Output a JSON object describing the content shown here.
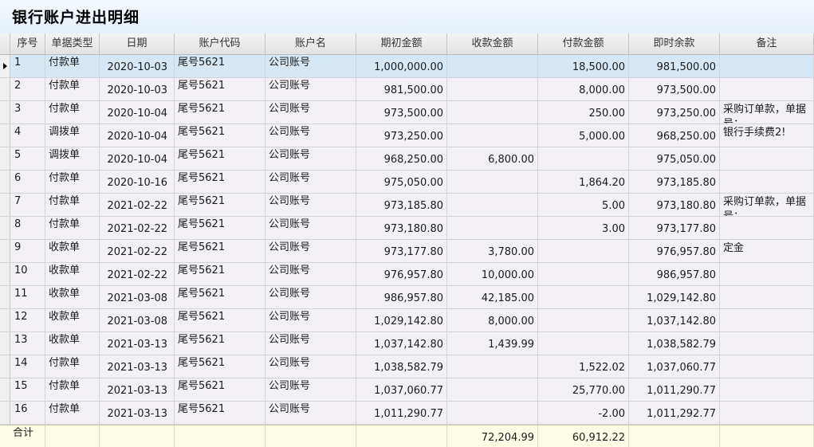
{
  "title": "银行账户进出明细",
  "columns": [
    "序号",
    "单据类型",
    "日期",
    "账户代码",
    "账户名",
    "期初金额",
    "收款金额",
    "付款金额",
    "即时余款",
    "备注"
  ],
  "rows": [
    {
      "idx": "1",
      "type": "付款单",
      "date": "2020-10-03",
      "code": "尾号5621",
      "name": "公司账号",
      "opening": "1,000,000.00",
      "receipt": "",
      "payment": "18,500.00",
      "balance": "981,500.00",
      "note": ""
    },
    {
      "idx": "2",
      "type": "付款单",
      "date": "2020-10-03",
      "code": "尾号5621",
      "name": "公司账号",
      "opening": "981,500.00",
      "receipt": "",
      "payment": "8,000.00",
      "balance": "973,500.00",
      "note": ""
    },
    {
      "idx": "3",
      "type": "付款单",
      "date": "2020-10-04",
      "code": "尾号5621",
      "name": "公司账号",
      "opening": "973,500.00",
      "receipt": "",
      "payment": "250.00",
      "balance": "973,250.00",
      "note": "采购订单款，单据号："
    },
    {
      "idx": "4",
      "type": "调拨单",
      "date": "2020-10-04",
      "code": "尾号5621",
      "name": "公司账号",
      "opening": "973,250.00",
      "receipt": "",
      "payment": "5,000.00",
      "balance": "968,250.00",
      "note": "银行手续费2!"
    },
    {
      "idx": "5",
      "type": "调拨单",
      "date": "2020-10-04",
      "code": "尾号5621",
      "name": "公司账号",
      "opening": "968,250.00",
      "receipt": "6,800.00",
      "payment": "",
      "balance": "975,050.00",
      "note": ""
    },
    {
      "idx": "6",
      "type": "付款单",
      "date": "2020-10-16",
      "code": "尾号5621",
      "name": "公司账号",
      "opening": "975,050.00",
      "receipt": "",
      "payment": "1,864.20",
      "balance": "973,185.80",
      "note": ""
    },
    {
      "idx": "7",
      "type": "付款单",
      "date": "2021-02-22",
      "code": "尾号5621",
      "name": "公司账号",
      "opening": "973,185.80",
      "receipt": "",
      "payment": "5.00",
      "balance": "973,180.80",
      "note": "采购订单款，单据号："
    },
    {
      "idx": "8",
      "type": "付款单",
      "date": "2021-02-22",
      "code": "尾号5621",
      "name": "公司账号",
      "opening": "973,180.80",
      "receipt": "",
      "payment": "3.00",
      "balance": "973,177.80",
      "note": ""
    },
    {
      "idx": "9",
      "type": "收款单",
      "date": "2021-02-22",
      "code": "尾号5621",
      "name": "公司账号",
      "opening": "973,177.80",
      "receipt": "3,780.00",
      "payment": "",
      "balance": "976,957.80",
      "note": "定金"
    },
    {
      "idx": "10",
      "type": "收款单",
      "date": "2021-02-22",
      "code": "尾号5621",
      "name": "公司账号",
      "opening": "976,957.80",
      "receipt": "10,000.00",
      "payment": "",
      "balance": "986,957.80",
      "note": ""
    },
    {
      "idx": "11",
      "type": "收款单",
      "date": "2021-03-08",
      "code": "尾号5621",
      "name": "公司账号",
      "opening": "986,957.80",
      "receipt": "42,185.00",
      "payment": "",
      "balance": "1,029,142.80",
      "note": ""
    },
    {
      "idx": "12",
      "type": "收款单",
      "date": "2021-03-08",
      "code": "尾号5621",
      "name": "公司账号",
      "opening": "1,029,142.80",
      "receipt": "8,000.00",
      "payment": "",
      "balance": "1,037,142.80",
      "note": ""
    },
    {
      "idx": "13",
      "type": "收款单",
      "date": "2021-03-13",
      "code": "尾号5621",
      "name": "公司账号",
      "opening": "1,037,142.80",
      "receipt": "1,439.99",
      "payment": "",
      "balance": "1,038,582.79",
      "note": ""
    },
    {
      "idx": "14",
      "type": "付款单",
      "date": "2021-03-13",
      "code": "尾号5621",
      "name": "公司账号",
      "opening": "1,038,582.79",
      "receipt": "",
      "payment": "1,522.02",
      "balance": "1,037,060.77",
      "note": ""
    },
    {
      "idx": "15",
      "type": "付款单",
      "date": "2021-03-13",
      "code": "尾号5621",
      "name": "公司账号",
      "opening": "1,037,060.77",
      "receipt": "",
      "payment": "25,770.00",
      "balance": "1,011,290.77",
      "note": ""
    },
    {
      "idx": "16",
      "type": "付款单",
      "date": "2021-03-13",
      "code": "尾号5621",
      "name": "公司账号",
      "opening": "1,011,290.77",
      "receipt": "",
      "payment": "-2.00",
      "balance": "1,011,292.77",
      "note": ""
    }
  ],
  "total": {
    "label": "合计",
    "receipt": "72,204.99",
    "payment": "60,912.22"
  },
  "colors": {
    "row_bg": "#f3f1f6",
    "selected_bg": "#d6e8f5",
    "total_bg": "#fefee6",
    "header_bg": "#e8e8e8"
  }
}
